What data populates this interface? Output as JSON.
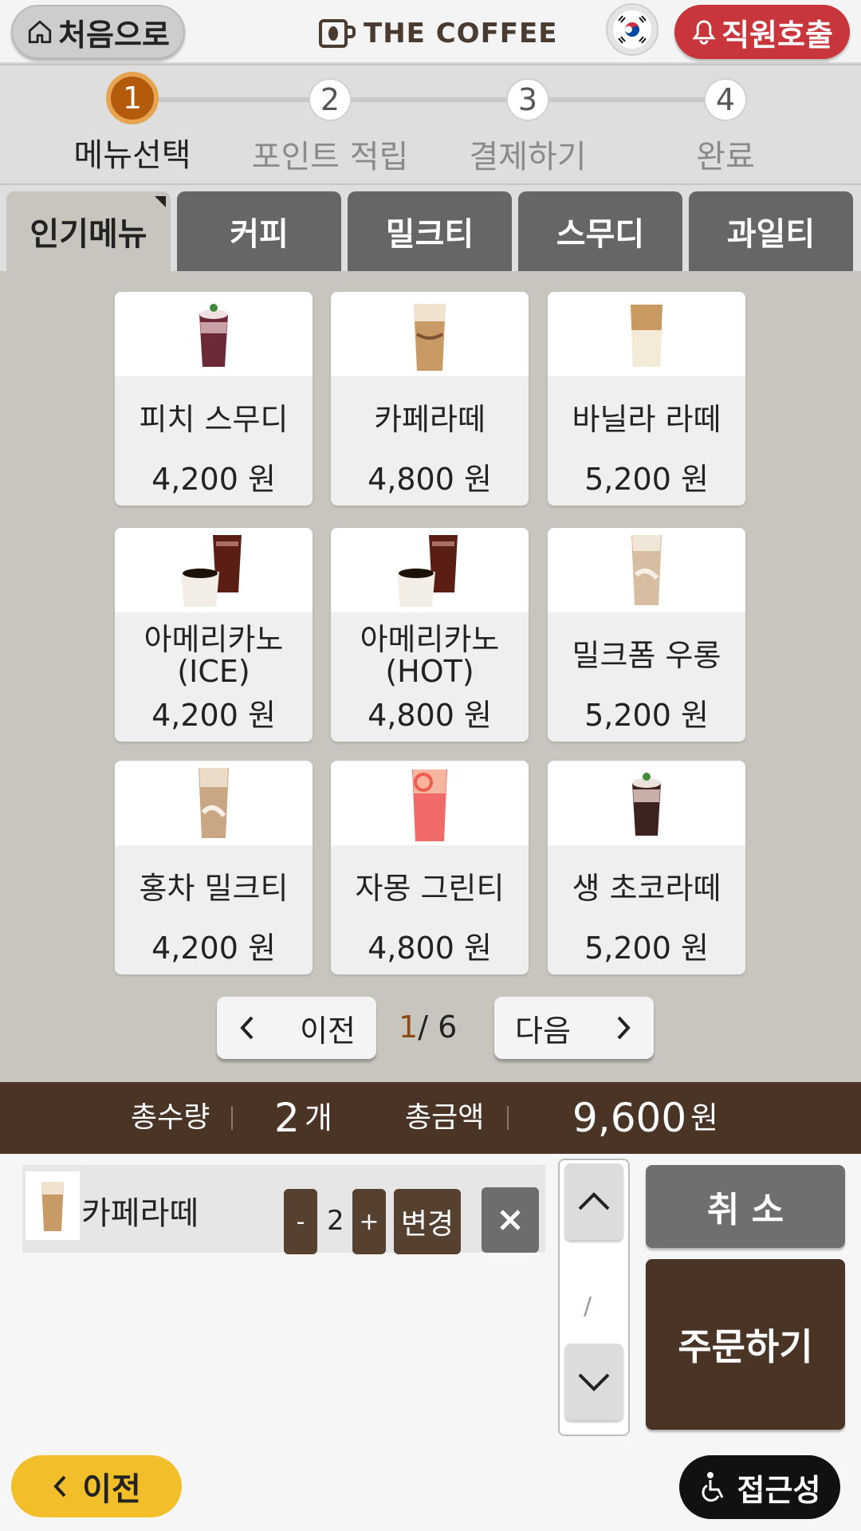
{
  "header": {
    "home_label": "처음으로",
    "brand": "THE COFFEE",
    "call_label": "직원호출"
  },
  "steps": [
    {
      "num": "1",
      "label": "메뉴선택",
      "active": true
    },
    {
      "num": "2",
      "label": "포인트 적립",
      "active": false
    },
    {
      "num": "3",
      "label": "결제하기",
      "active": false
    },
    {
      "num": "4",
      "label": "완료",
      "active": false
    }
  ],
  "tabs": [
    "인기메뉴",
    "커피",
    "밀크티",
    "스무디",
    "과일티"
  ],
  "menu": [
    {
      "name": "피치 스무디",
      "price": "4,200 원",
      "icon": "smoothie-icon"
    },
    {
      "name": "카페라떼",
      "price": "4,800 원",
      "icon": "latte-icon"
    },
    {
      "name": "바닐라 라떼",
      "price": "5,200 원",
      "icon": "latte-icon"
    },
    {
      "name": "아메리카노",
      "name2": "(ICE)",
      "price": "4,200 원",
      "icon": "americano-icon"
    },
    {
      "name": "아메리카노",
      "name2": "(HOT)",
      "price": "4,800 원",
      "icon": "americano-icon"
    },
    {
      "name": "밀크폼 우롱",
      "price": "5,200 원",
      "icon": "milk-tea-icon"
    },
    {
      "name": "홍차 밀크티",
      "price": "4,200 원",
      "icon": "milk-tea-icon"
    },
    {
      "name": "자몽 그린티",
      "price": "4,800 원",
      "icon": "grapefruit-tea-icon"
    },
    {
      "name": "생 초코라떼",
      "price": "5,200 원",
      "icon": "choco-latte-icon"
    }
  ],
  "pager": {
    "prev": "이전",
    "next": "다음",
    "current": "1",
    "total": "/ 6"
  },
  "totals": {
    "qty_label": "총수량",
    "qty": "2",
    "qty_unit": "개",
    "amount_label": "총금액",
    "amount": "9,600",
    "amount_unit": "원"
  },
  "cart": {
    "items": [
      {
        "name": "카페라떼",
        "qty": "2",
        "change": "변경"
      }
    ],
    "minus": "-",
    "plus": "+",
    "scroll_indicator": "/"
  },
  "actions": {
    "cancel": "취 소",
    "order": "주문하기"
  },
  "footer": {
    "back": "이전",
    "accessibility": "접근성"
  },
  "colors": {
    "brown": "#4a3426",
    "accent": "#b35a0b",
    "call_red": "#c8353b",
    "back_yellow": "#f2bf2a"
  }
}
